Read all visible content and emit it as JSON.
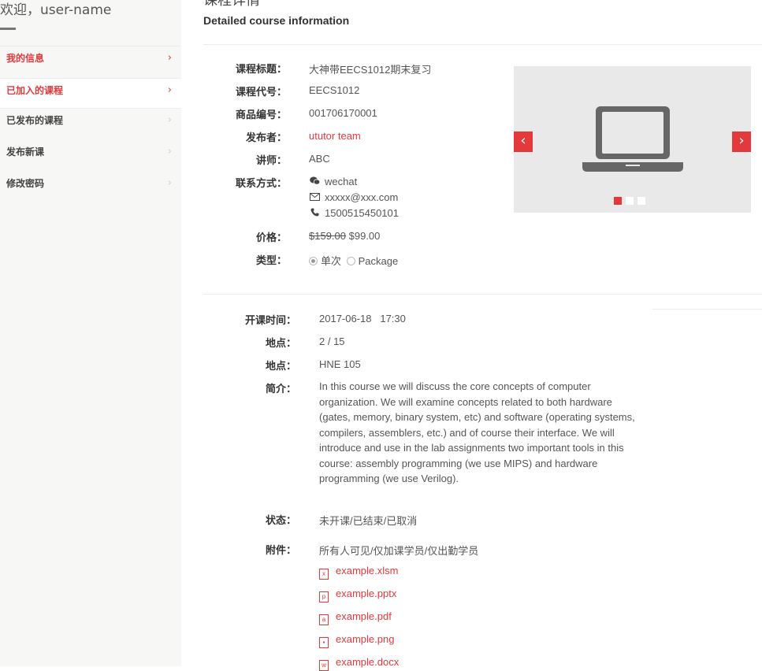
{
  "sidebar": {
    "welcome": "欢迎，user-name",
    "items": [
      {
        "label": "我的信息",
        "chevron": "›"
      },
      {
        "label": "已加入的课程",
        "chevron": "›"
      },
      {
        "label": "已发布的课程",
        "chevron": "›"
      },
      {
        "label": "发布新课",
        "chevron": "›"
      },
      {
        "label": "修改密码",
        "chevron": "›"
      }
    ]
  },
  "header": {
    "title_fragment": "课程详情",
    "subtitle": "Detailed course information"
  },
  "course": {
    "title_label": "课程标题：",
    "title": "大神带EECS1012期末复习",
    "code_label": "课程代号：",
    "code": "EECS1012",
    "product_label": "商品编号：",
    "product_no": "001706170001",
    "publisher_label": "发布者：",
    "publisher": "ututor team",
    "teacher_label": "讲师：",
    "teacher": "ABC",
    "contact_label": "联系方式：",
    "contact_wechat": "wechat",
    "contact_email": "xxxxx@xxx.com",
    "contact_phone": "1500515450101",
    "price_label": "价格：",
    "price_original": "$159.00",
    "price_current": "$99.00",
    "type_label": "类型：",
    "type_option_single": "单次",
    "type_option_package": "Package"
  },
  "carousel": {
    "prev": "‹",
    "next": "›",
    "slide_count": 3,
    "active_slide": 1,
    "image_icon": "laptop-icon",
    "accent_color": "#e4393c"
  },
  "schedule": {
    "start_label": "开课时间：",
    "start": "2017-06-18   17:30",
    "seats_label": "地点：",
    "seats": "2 / 15",
    "location_label": "地点：",
    "location": "HNE 105",
    "intro_label": "简介：",
    "intro": "In this course we will discuss the core concepts of computer organization. We will examine concepts related to both hardware (gates, memory, binary system, etc) and software (operating systems, compilers, assemblers, etc.) and of course their interface. We will introduce and use in the lab assignments two important tools in this course: assembly programming (we use MIPS) and hardware programming (we use Verilog).",
    "status_label": "状态：",
    "status": "未开课/已结束/已取消",
    "attach_label": "附件：",
    "attach_visibility": "所有人可见/仅加课学员/仅出勤学员",
    "files": [
      {
        "name": "example.xlsm",
        "icon": "excel-file-icon",
        "glyph": "x"
      },
      {
        "name": "example.pptx",
        "icon": "powerpoint-file-icon",
        "glyph": "p"
      },
      {
        "name": "example.pdf",
        "icon": "pdf-file-icon",
        "glyph": "a"
      },
      {
        "name": "example.png",
        "icon": "image-file-icon",
        "glyph": "▪"
      },
      {
        "name": "example.docx",
        "icon": "word-file-icon",
        "glyph": "w"
      }
    ]
  }
}
